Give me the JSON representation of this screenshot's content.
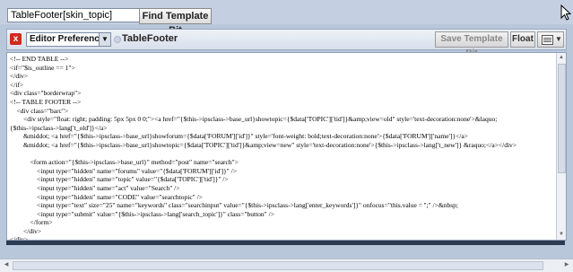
{
  "search": {
    "value": "TableFooter[skin_topic]",
    "button_label": "Find Template Bit"
  },
  "toolbar": {
    "close_label": "x",
    "preferences_label": "Editor Preferences",
    "bit_name": "TableFooter",
    "save_label": "Save Template Bit",
    "float_label": "Float",
    "menu_icon": "list-menu-icon"
  },
  "editor": {
    "lines": [
      "<!-- END TABLE -->",
      "<if=\"$is_outline == 1\">",
      "</div>",
      "</if>",
      "<div class=\"borderwrap\">",
      "<!-- TABLE FOOTER -->",
      "    <div class=\"barc\">",
      "        <div style=\"float: right; padding: 5px 5px 0 0;\"><a href=\"{$this->ipsclass->base_url}showtopic={$data['TOPIC']['tid']}&amp;view=old\" style='text-decoration:none'>&laquo;",
      "{$this->ipsclass->lang['t_old']}</a>",
      "        &middot; <a href=\"{$this->ipsclass->base_url}showforum={$data['FORUM']['id']}\" style='font-weight: bold;text-decoration:none'>{$data['FORUM']['name']}</a>",
      "        &middot; <a href=\"{$this->ipsclass->base_url}showtopic={$data['TOPIC']['tid']}&amp;view=new\" style='text-decoration:none'>{$this->ipsclass->lang['t_new']} &raquo;</a></div>",
      "",
      "            <form action=\"{$this->ipsclass->base_url}\" method=\"post\" name=\"search\">",
      "                <input type=\"hidden\" name=\"forums\" value=\"{$data['FORUM']['id']}\" />",
      "                <input type=\"hidden\" name=\"topic\" value=\"{$data['TOPIC']['tid']}\" />",
      "                <input type=\"hidden\" name=\"act\" value=\"Search\" />",
      "                <input type=\"hidden\" name=\"CODE\" value=\"searchtopic\" />",
      "                <input type=\"text\" size=\"25\" name=\"keywords\" class=\"searchinput\" value=\"{$this->ipsclass->lang['enter_keywords']}\" onfocus=\"this.value = '';\" />&nbsp;",
      "                <input type=\"submit\" value=\"{$this->ipsclass->lang['search_topic']}\" class=\"button\" />",
      "            </form>",
      "        </div>",
      "</div>"
    ]
  }
}
